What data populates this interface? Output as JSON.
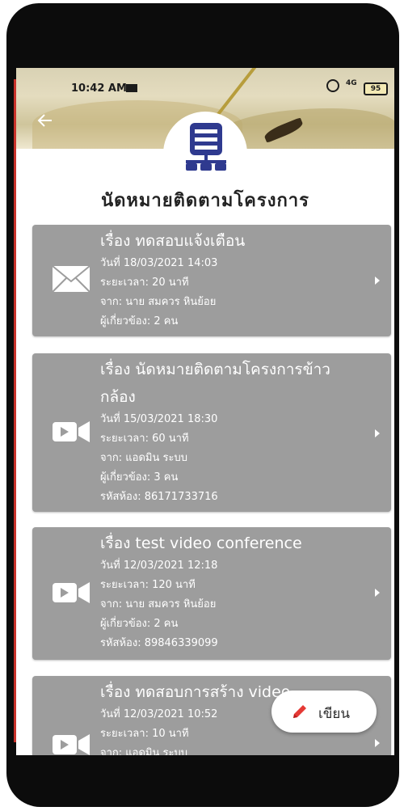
{
  "status_bar": {
    "time": "10:42 AM",
    "signal": "4G",
    "battery": "95"
  },
  "page": {
    "title": "นัดหมายติดตามโครงการ"
  },
  "labels": {
    "subject_prefix": "เรื่อง",
    "date_prefix": "วันที่",
    "duration_prefix": "ระยะเวลา:",
    "from_prefix": "จาก:",
    "participants_prefix": "ผู้เกี่ยวข้อง:",
    "room_prefix": "รหัสห้อง:"
  },
  "items": [
    {
      "type_icon": "envelope-icon",
      "subject": "เรื่อง  ทดสอบแจ้งเตือน",
      "date": "วันที่ 18/03/2021  14:03",
      "duration": "ระยะเวลา:  20 นาที",
      "from": "จาก:  นาย สมควร หินย้อย",
      "participants": "ผู้เกี่ยวข้อง:  2 คน",
      "room": ""
    },
    {
      "type_icon": "video-camera-icon",
      "subject": "เรื่อง  นัดหมายติดตามโครงการข้าวกล้อง",
      "subject_line1": "เรื่อง  นัดหมายติดตามโครงการข้าว",
      "subject_line2": "กล้อง",
      "date": "วันที่ 15/03/2021  18:30",
      "duration": "ระยะเวลา:  60 นาที",
      "from": "จาก:  แอดมิน ระบบ",
      "participants": "ผู้เกี่ยวข้อง:  3 คน",
      "room": "รหัสห้อง:  86171733716"
    },
    {
      "type_icon": "video-camera-icon",
      "subject": "เรื่อง  test video conference",
      "date": "วันที่ 12/03/2021  12:18",
      "duration": "ระยะเวลา:  120 นาที",
      "from": "จาก:  นาย สมควร หินย้อย",
      "participants": "ผู้เกี่ยวข้อง:  2 คน",
      "room": "รหัสห้อง:  89846339099"
    },
    {
      "type_icon": "video-camera-icon",
      "subject": "เรื่อง  ทดสอบการสร้าง video",
      "date": "วันที่ 12/03/2021  10:52",
      "duration": "ระยะเวลา:  10 นาที",
      "from": "จาก:  แอดมิน ระบบ",
      "participants": "",
      "room": ""
    }
  ],
  "fab": {
    "label": "เขียน",
    "icon": "pencil-icon"
  },
  "colors": {
    "card_bg": "#9d9d9d",
    "accent_icon": "#e53935",
    "logo_blue": "#2f3a8f"
  }
}
